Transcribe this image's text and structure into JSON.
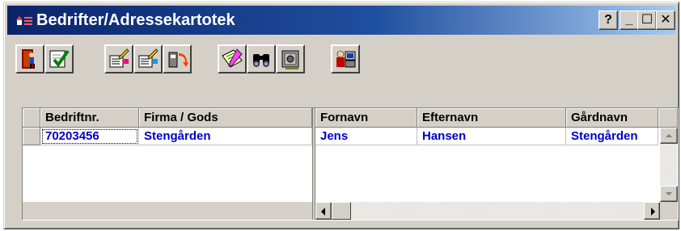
{
  "window": {
    "title": "Bedrifter/Adressekartotek",
    "help_label": "?",
    "minimize_label": "_",
    "maximize_label": "☐",
    "close_label": "✕"
  },
  "toolbar": {
    "buttons": [
      {
        "name": "exit-door-icon"
      },
      {
        "name": "checkmark-icon"
      },
      {
        "name": "edit-list-icon"
      },
      {
        "name": "edit-list-alt-icon"
      },
      {
        "name": "undo-icon"
      },
      {
        "name": "pencil-note-icon"
      },
      {
        "name": "binoculars-search-icon"
      },
      {
        "name": "safe-icon"
      },
      {
        "name": "user-computer-icon"
      }
    ]
  },
  "grid": {
    "left_columns": [
      "Bedriftnr.",
      "Firma / Gods"
    ],
    "right_columns": [
      "Fornavn",
      "Efternavn",
      "Gårdnavn"
    ],
    "rows": [
      {
        "bedriftnr": "70203456",
        "firma": "Stengården",
        "fornavn": "Jens",
        "efternavn": "Hansen",
        "gardnavn": "Stengården"
      }
    ]
  },
  "colors": {
    "title_start": "#0a246a",
    "title_end": "#a6caf0",
    "row_text": "#0000c8",
    "face": "#d4d0c8"
  }
}
